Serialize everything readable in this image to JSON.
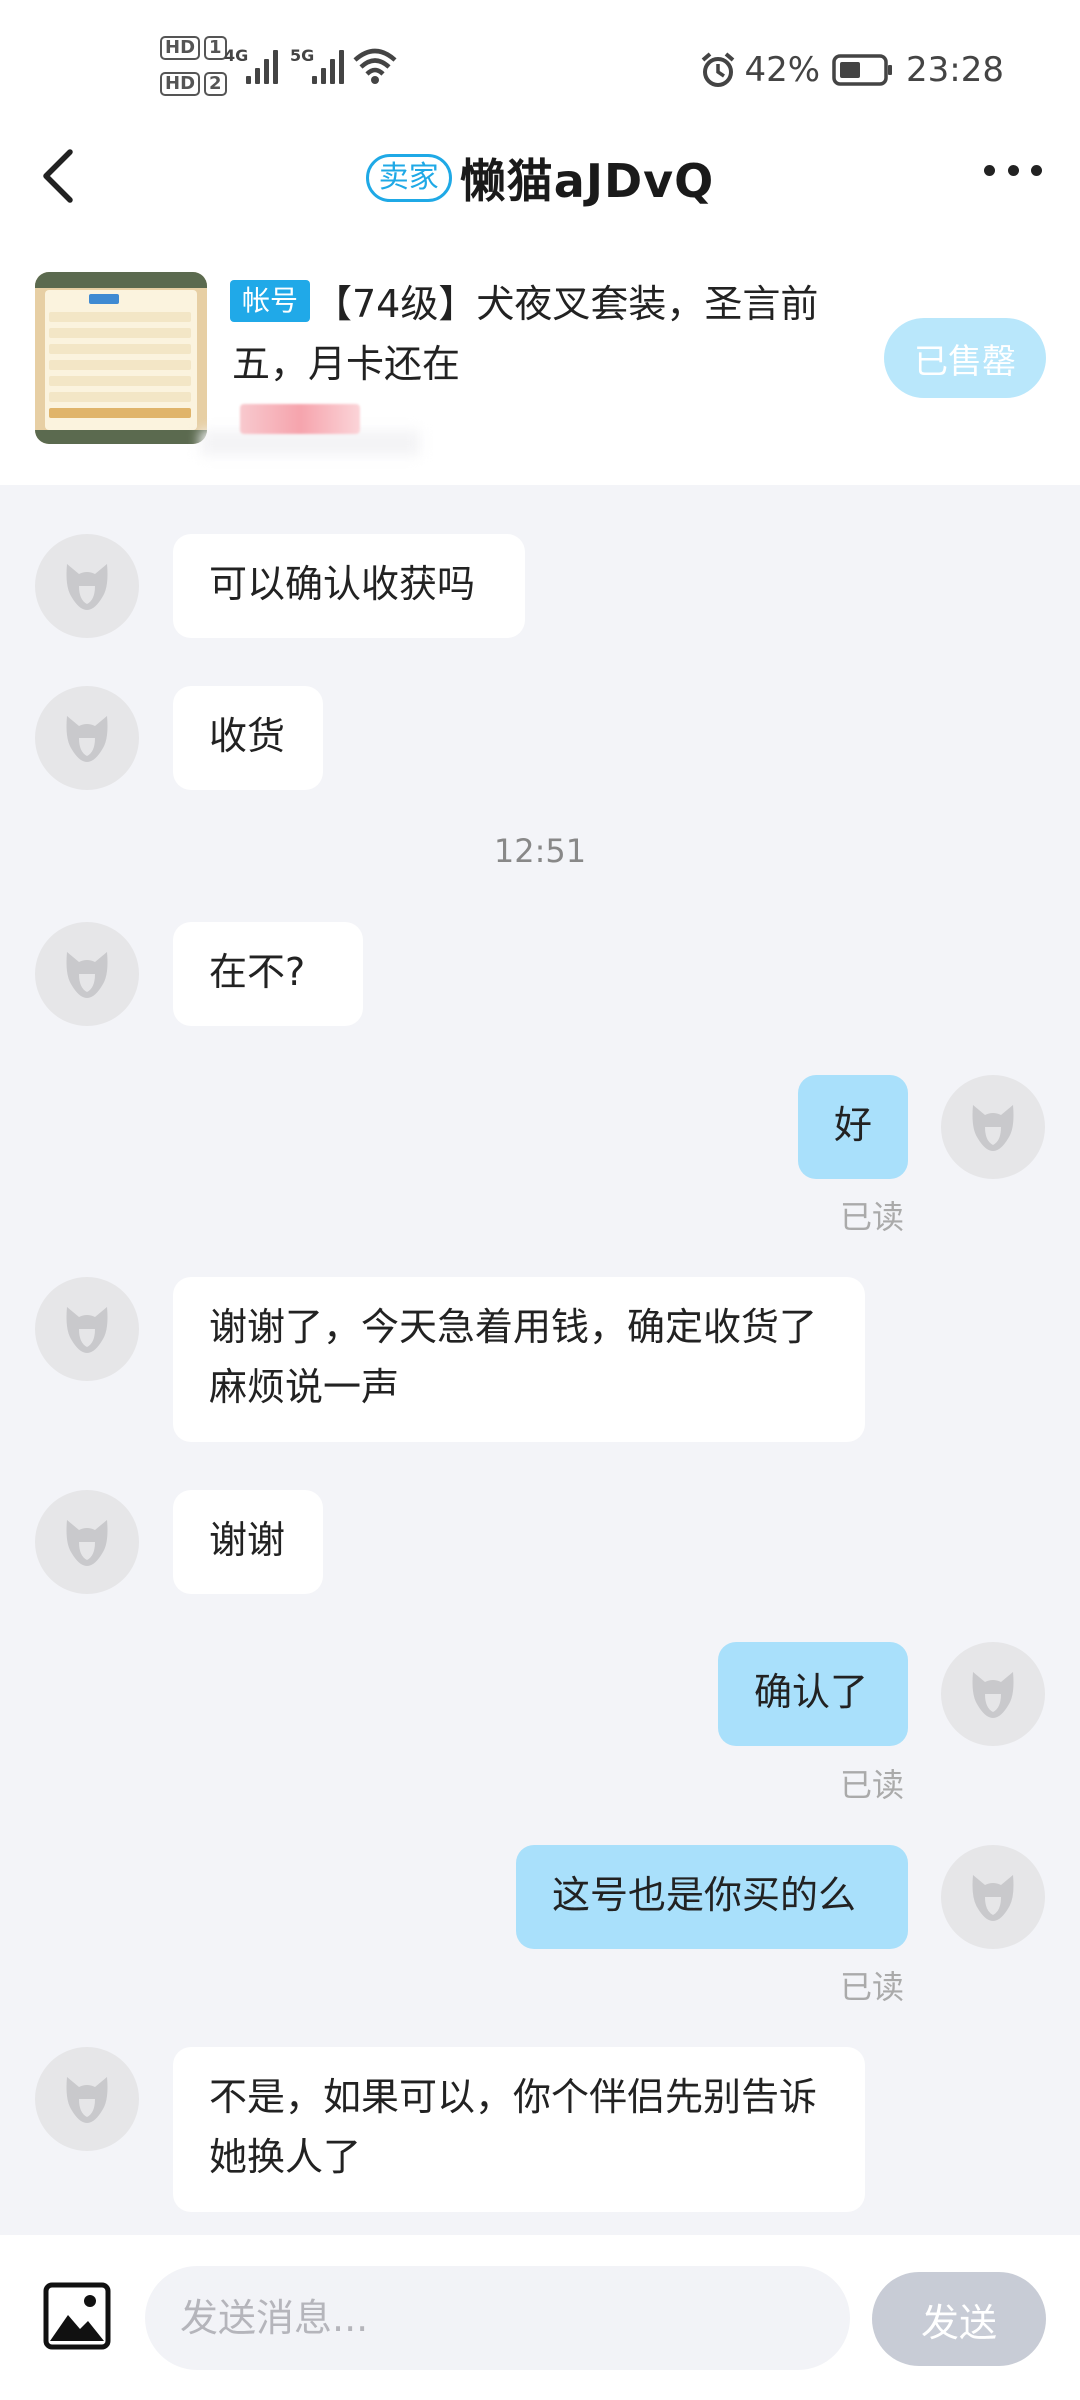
{
  "status_bar": {
    "hd1": "HD",
    "sim1": "1",
    "hd2": "HD",
    "sim2": "2",
    "net1": "4G",
    "net2": "5G",
    "battery": "42%",
    "time": "23:28"
  },
  "header": {
    "seller_badge": "卖家",
    "title": "懒猫aJDvQ"
  },
  "product": {
    "type_badge": "帐号",
    "title": "【74级】犬夜叉套装，圣言前五，月卡还在",
    "status_button": "已售罄"
  },
  "messages": [
    {
      "side": "in",
      "text": "可以确认收获吗"
    },
    {
      "side": "in",
      "text": "收货"
    },
    {
      "side": "in",
      "text": "在不?"
    },
    {
      "side": "out",
      "text": "好",
      "read": "已读"
    },
    {
      "side": "in",
      "text": "谢谢了，今天急着用钱，确定收货了麻烦说一声"
    },
    {
      "side": "in",
      "text": "谢谢"
    },
    {
      "side": "out",
      "text": "确认了",
      "read": "已读"
    },
    {
      "side": "out",
      "text": "这号也是你买的么",
      "read": "已读"
    },
    {
      "side": "in",
      "text": "不是，如果可以，你个伴侣先别告诉她换人了"
    }
  ],
  "time_separator": "12:51",
  "input": {
    "placeholder": "发送消息...",
    "send_label": "发送"
  },
  "colors": {
    "accent": "#20a9e8",
    "outgoing_bubble": "#a9e0fb",
    "background": "#f3f4f8"
  }
}
